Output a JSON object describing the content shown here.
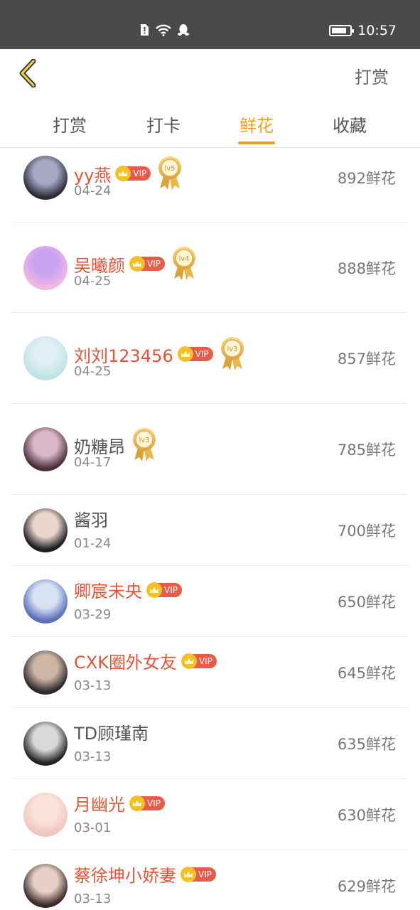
{
  "status_bar": {
    "time": "10:57",
    "battery_level": 0.85
  },
  "header": {
    "back_icon": "chevron-left-icon",
    "action_label": "打赏"
  },
  "tabs": [
    {
      "label": "打赏",
      "active": false
    },
    {
      "label": "打卡",
      "active": false
    },
    {
      "label": "鲜花",
      "active": true
    },
    {
      "label": "收藏",
      "active": false
    }
  ],
  "colors": {
    "accent": "#f0a020",
    "vip_name": "#e0553a",
    "vip_badge": "#e85a4a",
    "status_bar": "#4a4a4a"
  },
  "list": [
    {
      "name": "yy燕",
      "vip": true,
      "vip_label": "VIP",
      "level": "lv5",
      "date": "04-24",
      "amount": "892鲜花",
      "avatar_colors": [
        "#2b2b3a",
        "#a6a8c4"
      ]
    },
    {
      "name": "吴曦颜",
      "vip": true,
      "vip_label": "VIP",
      "level": "lv4",
      "date": "04-25",
      "amount": "888鲜花",
      "avatar_colors": [
        "#f2b6e6",
        "#c9a3f0"
      ]
    },
    {
      "name": "刘刘123456",
      "vip": true,
      "vip_label": "VIP",
      "level": "lv3",
      "date": "04-25",
      "amount": "857鲜花",
      "avatar_colors": [
        "#bfe3ea",
        "#dfeff2"
      ]
    },
    {
      "name": "奶糖昂",
      "vip": false,
      "vip_label": "",
      "level": "lv3",
      "date": "04-17",
      "amount": "785鲜花",
      "avatar_colors": [
        "#4a2f3b",
        "#d9b7c6"
      ]
    },
    {
      "name": "酱羽",
      "vip": false,
      "vip_label": "",
      "level": "",
      "date": "01-24",
      "amount": "700鲜花",
      "avatar_colors": [
        "#1d1d1f",
        "#e9d6cf"
      ]
    },
    {
      "name": "卿宸未央",
      "vip": true,
      "vip_label": "VIP",
      "level": "",
      "date": "03-29",
      "amount": "650鲜花",
      "avatar_colors": [
        "#5a6fb8",
        "#d8e2f5"
      ]
    },
    {
      "name": "CXK圈外女友",
      "vip": true,
      "vip_label": "VIP",
      "level": "",
      "date": "03-13",
      "amount": "645鲜花",
      "avatar_colors": [
        "#2e2a2a",
        "#cdb6a6"
      ]
    },
    {
      "name": "TD顾瑾南",
      "vip": false,
      "vip_label": "",
      "level": "",
      "date": "03-13",
      "amount": "635鲜花",
      "avatar_colors": [
        "#222222",
        "#d9d9d9"
      ]
    },
    {
      "name": "月幽光",
      "vip": true,
      "vip_label": "VIP",
      "level": "",
      "date": "03-01",
      "amount": "630鲜花",
      "avatar_colors": [
        "#f0c6bd",
        "#fae3dc"
      ]
    },
    {
      "name": "蔡徐坤小娇妻",
      "vip": true,
      "vip_label": "VIP",
      "level": "",
      "date": "03-13",
      "amount": "629鲜花",
      "avatar_colors": [
        "#3a2a2a",
        "#e7cfc6"
      ]
    }
  ]
}
